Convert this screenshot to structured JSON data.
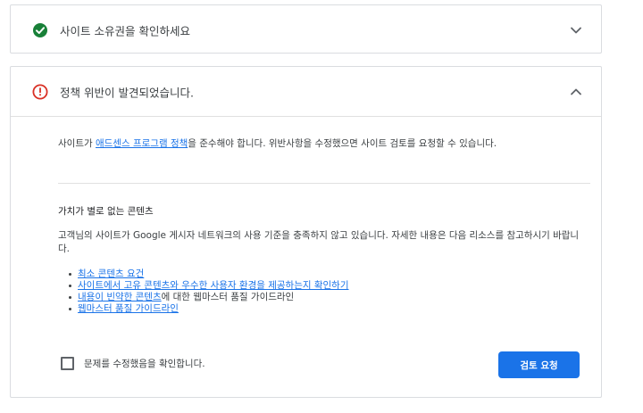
{
  "card_verify": {
    "title": "사이트 소유권을 확인하세요",
    "status_icon": "check-circle-icon",
    "status_color": "#188038",
    "chevron_icon": "chevron-down-icon"
  },
  "card_policy": {
    "title": "정책 위반이 발견되었습니다.",
    "status_icon": "error-circle-icon",
    "status_color": "#d93025",
    "chevron_icon": "chevron-up-icon",
    "intro": {
      "prefix": "사이트가 ",
      "link": "애드센스 프로그램 정책",
      "suffix": "을 준수해야 합니다. 위반사항을 수정했으면 사이트 검토를 요청할 수 있습니다."
    },
    "section_title": "가치가 별로 없는 콘텐츠",
    "section_desc": "고객님의 사이트가 Google 게시자 네트워크의 사용 기준을 충족하지 않고 있습니다. 자세한 내용은 다음 리소스를 참고하시기 바랍니다.",
    "resources": [
      {
        "link": "최소 콘텐츠 요건",
        "suffix": ""
      },
      {
        "link": "사이트에서 고유 콘텐츠와 우수한 사용자 환경을 제공하는지 확인하기",
        "suffix": ""
      },
      {
        "link": "내용이 빈약한 콘텐츠",
        "suffix": "에 대한 웹마스터 품질 가이드라인"
      },
      {
        "link": "웹마스터 품질 가이드라인",
        "suffix": ""
      }
    ],
    "checkbox_label": "문제를 수정했음을 확인합니다.",
    "checkbox_checked": false,
    "button_label": "검토 요청",
    "accent_color": "#1a73e8"
  }
}
